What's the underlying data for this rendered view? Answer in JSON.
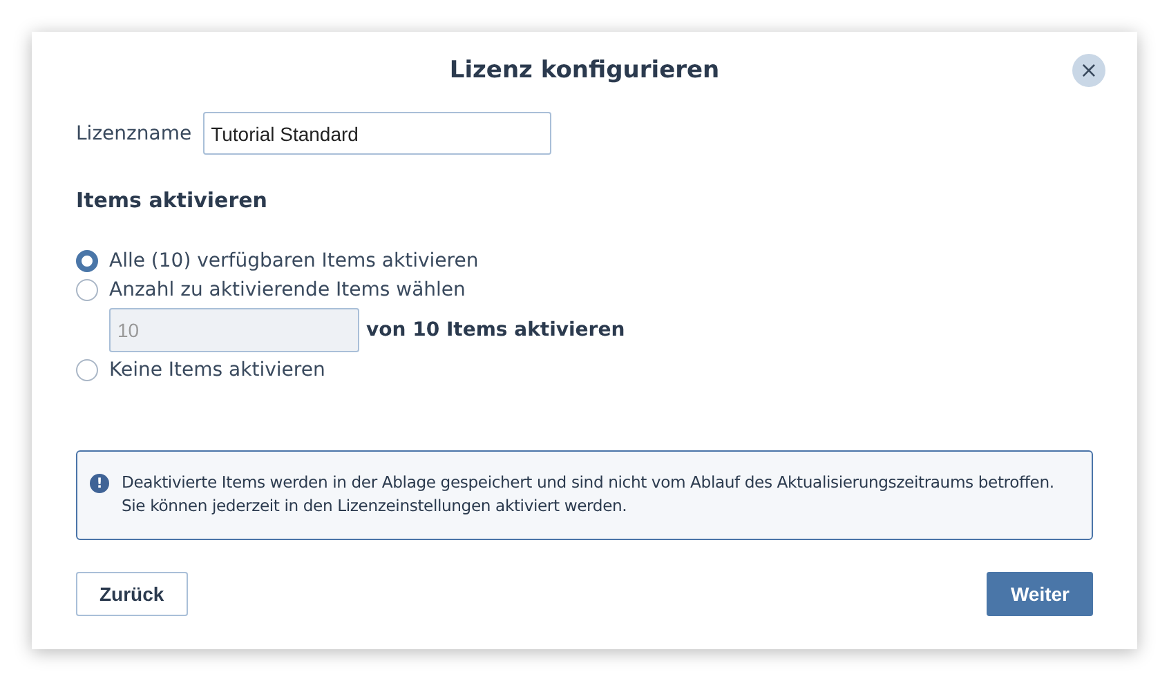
{
  "dialog": {
    "title": "Lizenz konfigurieren",
    "close_label": "×"
  },
  "license_name": {
    "label": "Lizenzname",
    "value": "Tutorial Standard"
  },
  "section": {
    "heading": "Items aktivieren"
  },
  "options": [
    {
      "label": "Alle (10) verfügbaren Items aktivieren",
      "selected": true
    },
    {
      "label": "Anzahl zu aktivierende Items wählen",
      "selected": false,
      "count_field": {
        "value": "10",
        "disabled": true,
        "suffix": "von 10 Items aktivieren"
      }
    },
    {
      "label": "Keine Items aktivieren",
      "selected": false
    }
  ],
  "info": {
    "icon": "!",
    "text": "Deaktivierte Items werden in der Ablage gespeichert und sind nicht vom Ablauf des Aktualisierungszeitraums betroffen. Sie können jederzeit in den Lizenzeinstellungen aktiviert werden."
  },
  "buttons": [
    {
      "label": "Zurück",
      "kind": "secondary"
    },
    {
      "label": "Weiter",
      "kind": "primary"
    }
  ]
}
